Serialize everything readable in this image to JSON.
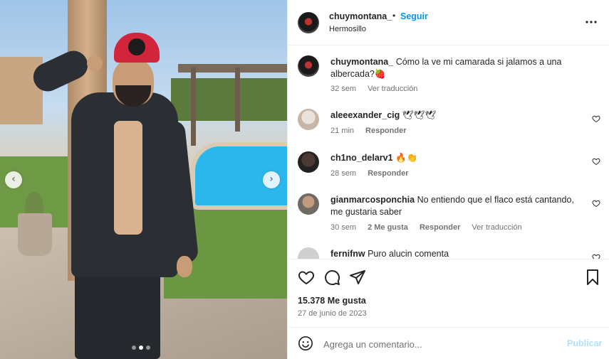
{
  "post": {
    "carousel": {
      "slide_count": 3,
      "active_slide": 2
    }
  },
  "header": {
    "username": "chuymontana_",
    "separator": "•",
    "follow_label": "Seguir",
    "location": "Hermosillo",
    "more_icon": "more-horizontal-icon"
  },
  "caption": {
    "username": "chuymontana_",
    "text": "Cómo la ve mi camarada si jalamos a una albercada?🍓",
    "time": "32 sem",
    "translate": "Ver traducción"
  },
  "comments": [
    {
      "username": "aleeexander_cig",
      "text": "🕊🕊🕊",
      "time": "21 min",
      "likes": "",
      "reply": "Responder",
      "translate": ""
    },
    {
      "username": "ch1no_delarv1",
      "text": "🔥👏",
      "time": "28 sem",
      "likes": "",
      "reply": "Responder",
      "translate": ""
    },
    {
      "username": "gianmarcosponchia",
      "text": "No entiendo que el flaco está cantando, me gustaria saber",
      "time": "30 sem",
      "likes": "2 Me gusta",
      "reply": "Responder",
      "translate": "Ver traducción"
    },
    {
      "username": "fernifnw",
      "text": "Puro alucin comenta",
      "time": "",
      "likes": "",
      "reply": "",
      "translate": ""
    }
  ],
  "actions": {
    "like_icon": "heart-icon",
    "comment_icon": "comment-icon",
    "share_icon": "send-icon",
    "save_icon": "bookmark-icon"
  },
  "likes_text": "15.378 Me gusta",
  "date_text": "27 de junio de 2023",
  "add_comment": {
    "placeholder": "Agrega un comentario...",
    "publish_label": "Publicar"
  },
  "colors": {
    "accent": "#0095f6",
    "publish_disabled": "#b2dffc",
    "meta_text": "#737373"
  }
}
